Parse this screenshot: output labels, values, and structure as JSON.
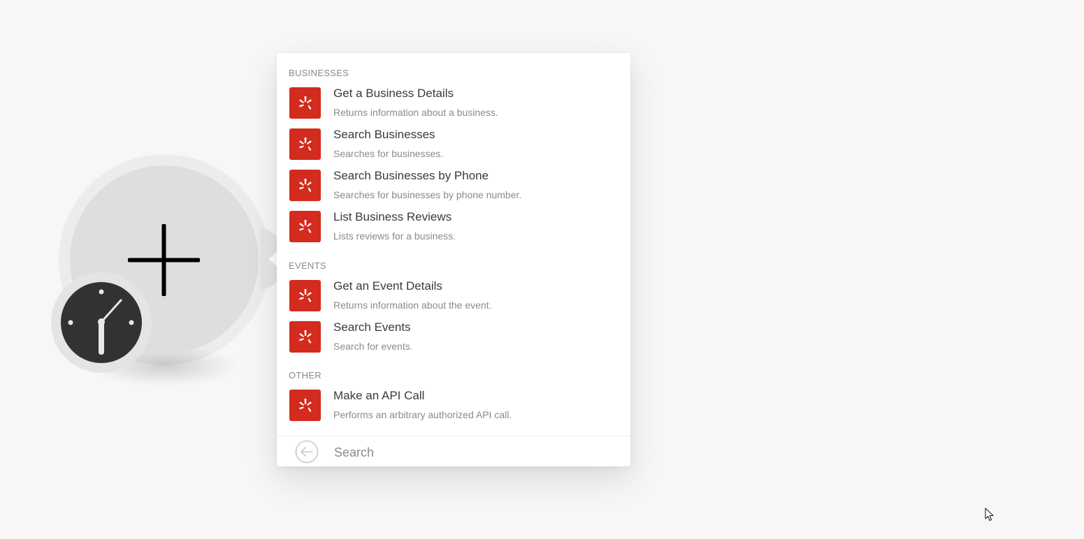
{
  "module": {
    "plus_icon": "plus-icon",
    "trigger_icon": "clock-icon"
  },
  "menu": {
    "sections": [
      {
        "header": "BUSINESSES",
        "items": [
          {
            "title": "Get a Business Details",
            "description": "Returns information about a business.",
            "icon": "yelp-icon"
          },
          {
            "title": "Search Businesses",
            "description": "Searches for businesses.",
            "icon": "yelp-icon"
          },
          {
            "title": "Search Businesses by Phone",
            "description": "Searches for businesses by phone number.",
            "icon": "yelp-icon"
          },
          {
            "title": "List Business Reviews",
            "description": "Lists reviews for a business.",
            "icon": "yelp-icon"
          }
        ]
      },
      {
        "header": "EVENTS",
        "items": [
          {
            "title": "Get an Event Details",
            "description": "Returns information about the event.",
            "icon": "yelp-icon"
          },
          {
            "title": "Search Events",
            "description": "Search for events.",
            "icon": "yelp-icon"
          }
        ]
      },
      {
        "header": "OTHER",
        "items": [
          {
            "title": "Make an API Call",
            "description": "Performs an arbitrary authorized API call.",
            "icon": "yelp-icon"
          }
        ]
      }
    ]
  },
  "search": {
    "placeholder": "Search",
    "value": "",
    "back_icon": "back-arrow-icon"
  },
  "colors": {
    "yelp_red": "#d32b1e",
    "background": "#f7f7f7",
    "title_text": "#3a3a3a",
    "muted_text": "#8a8a8a"
  }
}
